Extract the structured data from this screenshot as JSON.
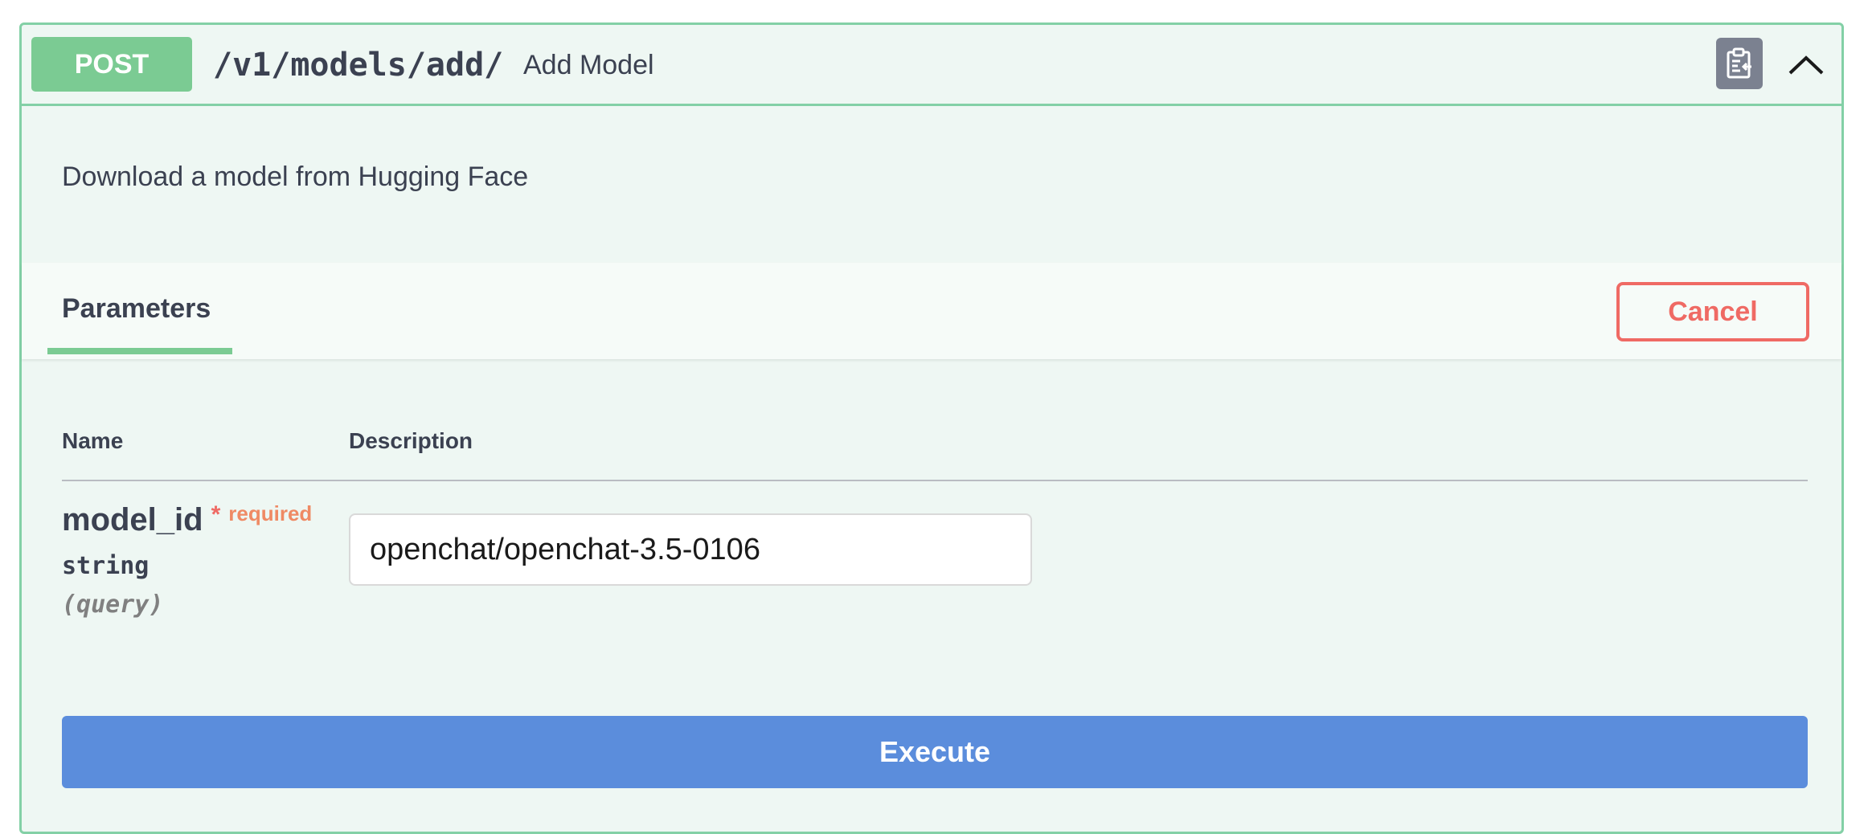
{
  "operation": {
    "method": "POST",
    "path": "/v1/models/add/",
    "summary": "Add Model",
    "description": "Download a model from Hugging Face",
    "copy_icon": "copy-to-clipboard-icon",
    "collapse_icon": "chevron-up-icon"
  },
  "parameters_section": {
    "tab_label": "Parameters",
    "cancel_label": "Cancel",
    "columns": {
      "name": "Name",
      "description": "Description"
    },
    "items": [
      {
        "name": "model_id",
        "required_star": "*",
        "required_label": "required",
        "type": "string",
        "in": "(query)",
        "value": "openchat/openchat-3.5-0106"
      }
    ]
  },
  "execute_label": "Execute",
  "colors": {
    "method_post": "#7bcb93",
    "block_border": "#83d0a6",
    "cancel": "#ef6a64",
    "execute": "#5b8ddc"
  }
}
